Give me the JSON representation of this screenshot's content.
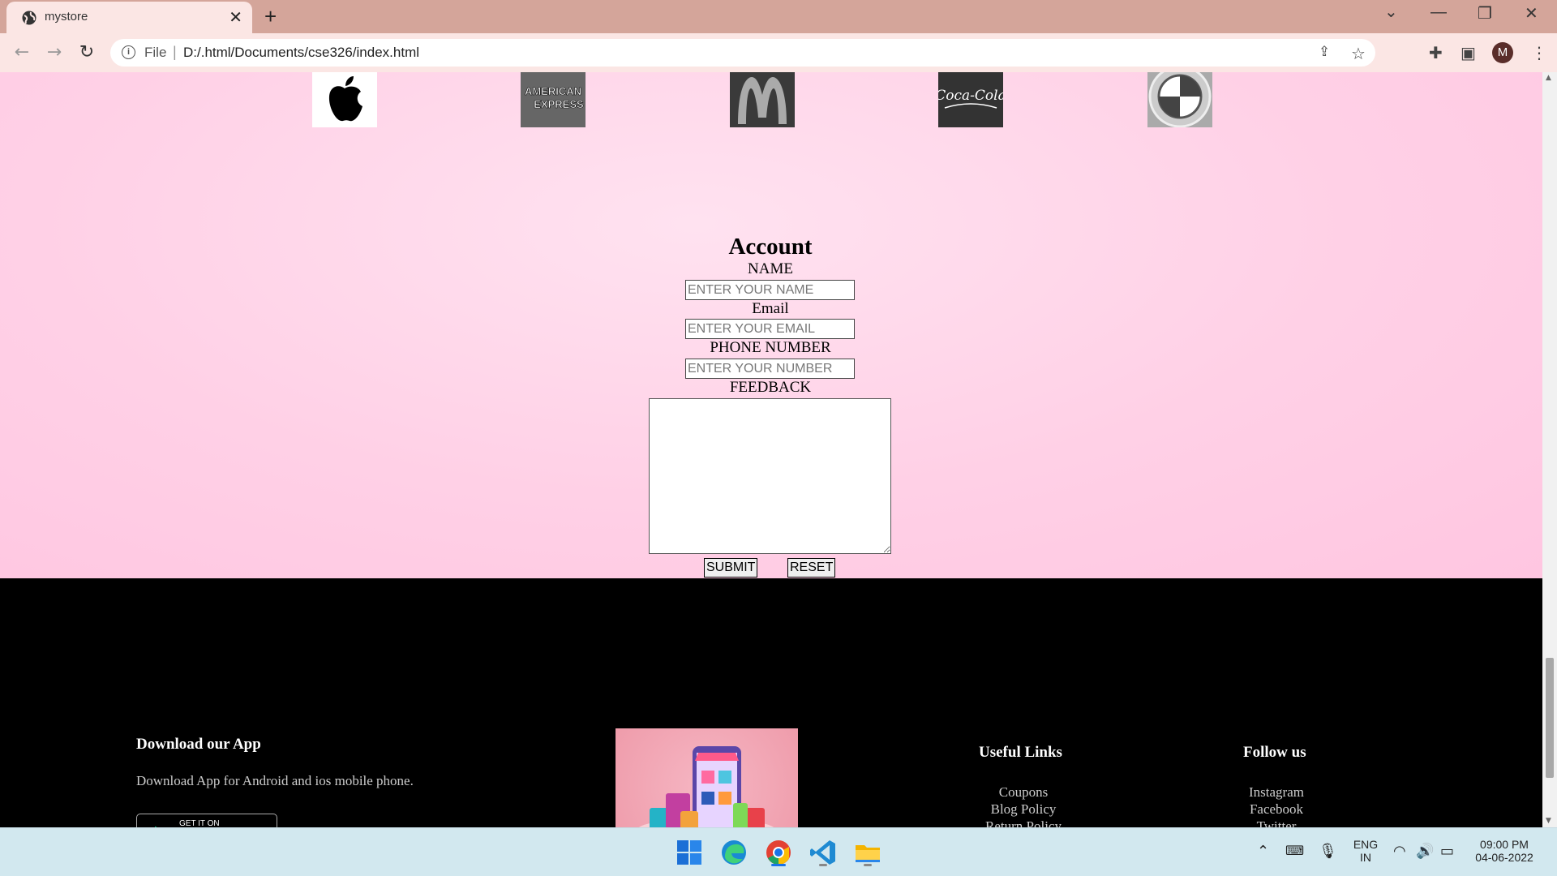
{
  "browser": {
    "tab_title": "mystore",
    "new_tab_symbol": "+",
    "close_symbol": "✕",
    "url_scheme": "File",
    "url_separator": "|",
    "url": "D:/.html/Documents/cse326/index.html",
    "profile_initial": "M",
    "window_controls": {
      "chevron": "⌄",
      "minimize": "—",
      "restore": "❐",
      "close": "✕"
    }
  },
  "logos": [
    {
      "name": "apple-logo",
      "bg": "#ffffff"
    },
    {
      "name": "american-express-logo",
      "text": "AMERICAN EXPRESS",
      "bg": "#666666"
    },
    {
      "name": "mcdonalds-logo",
      "bg": "#3a3a3a"
    },
    {
      "name": "coca-cola-logo",
      "text": "Coca-Cola",
      "bg": "#333333"
    },
    {
      "name": "bmw-logo",
      "text": "B M W",
      "bg": "#aaaaaa"
    }
  ],
  "form": {
    "title": "Account",
    "name_label": "NAME",
    "name_placeholder": "ENTER YOUR NAME",
    "email_label": "Email",
    "email_placeholder": "ENTER YOUR EMAIL",
    "phone_label": "PHONE NUMBER",
    "phone_placeholder": "ENTER YOUR NUMBER",
    "feedback_label": "FEEDBACK",
    "submit_label": "SUBMIT",
    "reset_label": "RESET"
  },
  "footer": {
    "download_heading": "Download our App",
    "download_text": "Download App for Android and ios mobile phone.",
    "play_badge_text": "GET IT ON",
    "useful_links_heading": "Useful Links",
    "useful_links": [
      "Coupons",
      "Blog Policy",
      "Return Policy"
    ],
    "follow_heading": "Follow us",
    "follow_links": [
      "Instagram",
      "Facebook",
      "Twitter"
    ]
  },
  "taskbar": {
    "apps": [
      "windows-start",
      "edge",
      "chrome",
      "vscode",
      "file-explorer"
    ],
    "lang_line1": "ENG",
    "lang_line2": "IN",
    "time": "09:00 PM",
    "date": "04-06-2022"
  },
  "colors": {
    "tabbar": "#d4a59a",
    "page_bg_pink": "#ffd0e6",
    "footer_bg": "#000000"
  }
}
